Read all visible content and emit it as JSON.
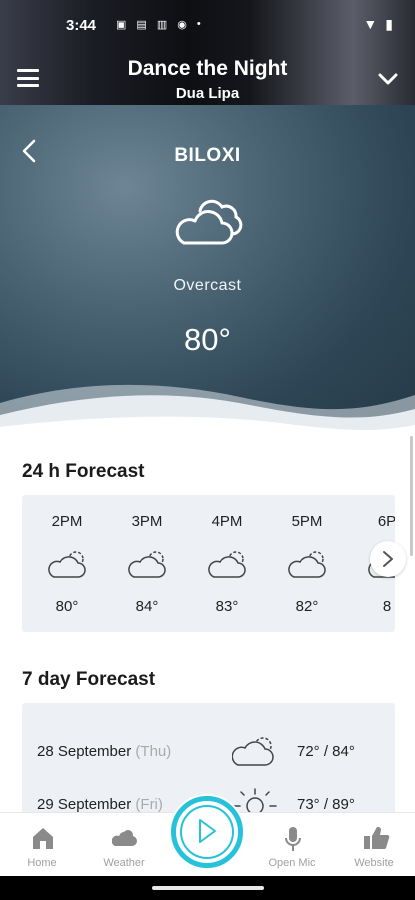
{
  "status_bar": {
    "time": "3:44"
  },
  "now_playing": {
    "title": "Dance the Night",
    "artist": "Dua Lipa"
  },
  "weather": {
    "city": "BILOXI",
    "condition": "Overcast",
    "temperature": "80°",
    "hourly_title": "24 h Forecast",
    "hourly": [
      {
        "time": "2PM",
        "temp": "80°",
        "icon": "partly-cloudy-icon"
      },
      {
        "time": "3PM",
        "temp": "84°",
        "icon": "partly-cloudy-icon"
      },
      {
        "time": "4PM",
        "temp": "83°",
        "icon": "partly-cloudy-icon"
      },
      {
        "time": "5PM",
        "temp": "82°",
        "icon": "partly-cloudy-icon"
      },
      {
        "time": "6P",
        "temp": "8",
        "icon": "partly-cloudy-icon"
      }
    ],
    "daily_title": "7 day Forecast",
    "daily": [
      {
        "date": "28 September",
        "dow": "(Thu)",
        "range": "72° / 84°",
        "icon": "partly-cloudy-icon"
      },
      {
        "date": "29 September",
        "dow": "(Fri)",
        "range": "73° / 89°",
        "icon": "sun-icon"
      }
    ]
  },
  "nav": {
    "home": "Home",
    "weather": "Weather",
    "open_mic": "Open Mic",
    "website": "Website"
  },
  "colors": {
    "accent": "#25c2d9"
  }
}
